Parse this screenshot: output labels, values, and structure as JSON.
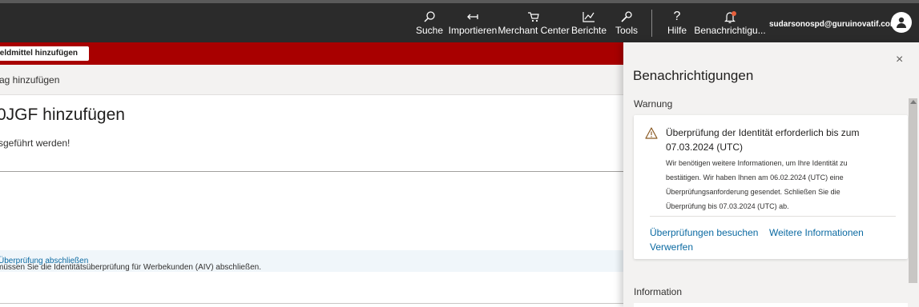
{
  "topbar": {
    "items": [
      {
        "label": "Suche",
        "icon": "search-icon"
      },
      {
        "label": "Importieren",
        "icon": "import-icon"
      },
      {
        "label": "Merchant Center",
        "icon": "cart-icon"
      },
      {
        "label": "Berichte",
        "icon": "chart-icon"
      },
      {
        "label": "Tools",
        "icon": "wrench-icon"
      },
      {
        "label": "Hilfe",
        "icon": "help-icon"
      },
      {
        "label": "Benachrichtigu...",
        "icon": "bell-icon"
      }
    ],
    "email": "sudarsonospd@guruinovatif.com",
    "badge_color": "#e8603c"
  },
  "main": {
    "red_button_label": "ieldmittel hinzufügen",
    "grey_bar_text": "ag hinzufügen",
    "heading": "0JGF hinzufügen",
    "subtext": "sgeführt werden!",
    "info_text": "müssen Sie die Identitätsüberprüfung für Werbekunden (AIV) abschließen.",
    "info_link": "Überprüfung abschließen",
    "accent_red": "#a80000"
  },
  "panel": {
    "title": "Benachrichtigungen",
    "warning_label": "Warnung",
    "card": {
      "title": "Überprüfung der Identität erforderlich bis zum 07.03.2024 (UTC)",
      "body": "Wir benötigen weitere Informationen, um Ihre Identität zu bestätigen. Wir haben Ihnen am 06.02.2024 (UTC) eine Überprüfungsanforderung gesendet. Schließen Sie die Überprüfung bis 07.03.2024 (UTC) ab.",
      "link_visit": "Überprüfungen besuchen",
      "link_more": "Weitere Informationen",
      "link_dismiss": "Verwerfen",
      "icon": "warning-icon"
    },
    "information_label": "Information",
    "close_glyph": "×"
  }
}
